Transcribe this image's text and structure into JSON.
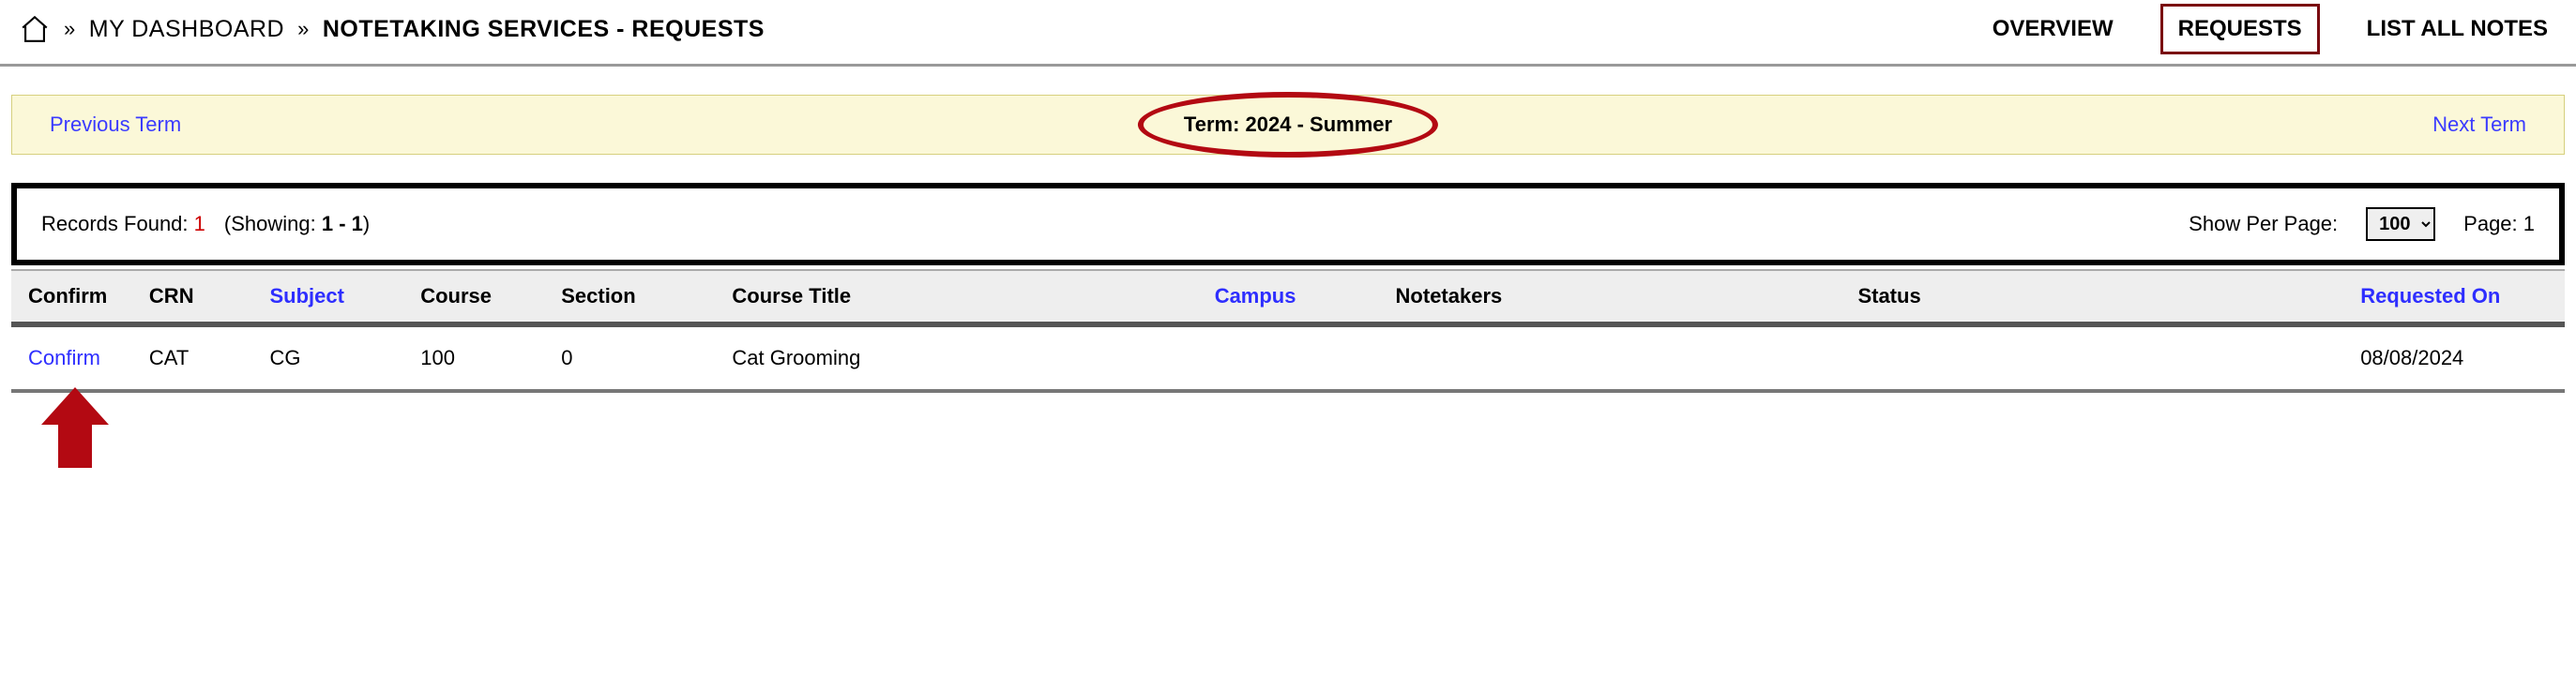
{
  "breadcrumb": {
    "dashboard": "MY DASHBOARD",
    "page": "NOTETAKING SERVICES - REQUESTS"
  },
  "topnav": {
    "overview": "OVERVIEW",
    "requests": "REQUESTS",
    "list_all": "LIST ALL NOTES"
  },
  "termbar": {
    "prev": "Previous Term",
    "label": "Term: 2024 - Summer",
    "next": "Next Term"
  },
  "records": {
    "found_label": "Records Found:",
    "found_count": "1",
    "showing_prefix": "(Showing:",
    "showing_range": "1 - 1",
    "showing_suffix": ")",
    "perpage_label": "Show Per Page:",
    "perpage_value": "100",
    "page_label": "Page: 1"
  },
  "table": {
    "headers": {
      "confirm": "Confirm",
      "crn": "CRN",
      "subject": "Subject",
      "course": "Course",
      "section": "Section",
      "title": "Course Title",
      "campus": "Campus",
      "notetakers": "Notetakers",
      "status": "Status",
      "requested": "Requested On"
    },
    "rows": [
      {
        "confirm": "Confirm",
        "crn": "CAT",
        "subject": "CG",
        "course": "100",
        "section": "0",
        "title": "Cat Grooming",
        "campus": "",
        "notetakers": "",
        "status": "",
        "requested": "08/08/2024"
      }
    ]
  }
}
